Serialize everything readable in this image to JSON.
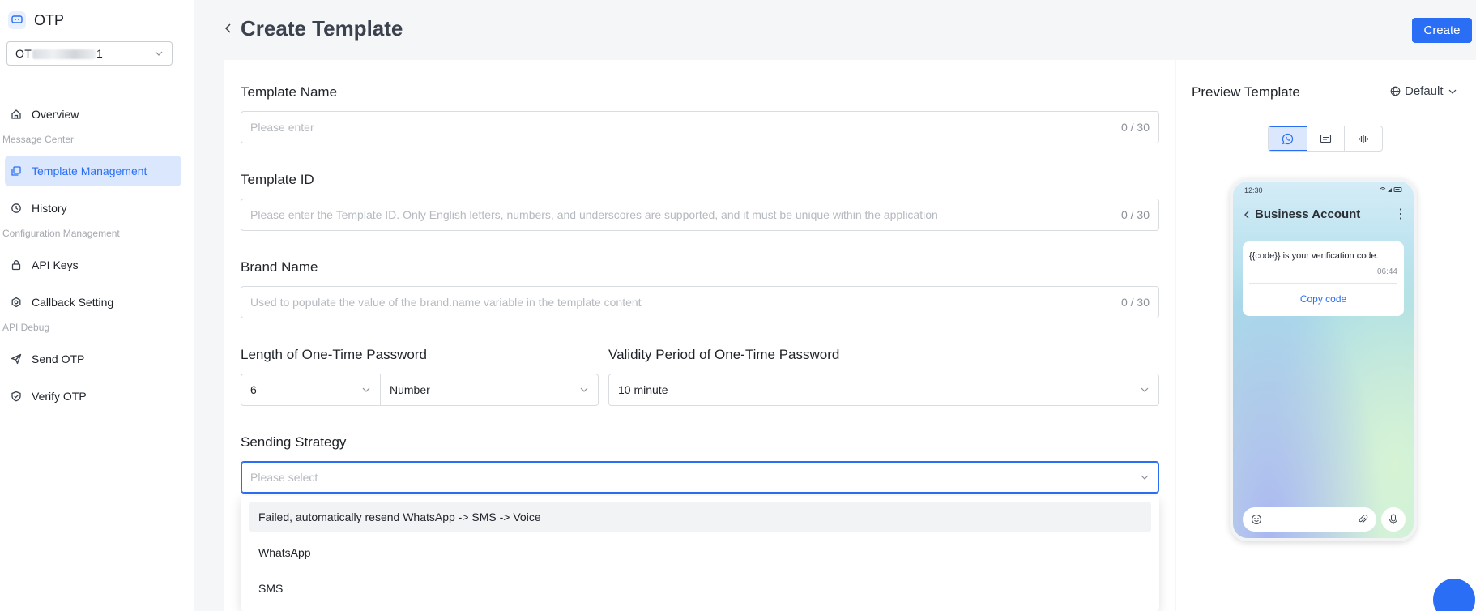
{
  "sidebar": {
    "app_title": "OTP",
    "app_select": {
      "prefix": "OT",
      "suffix": "1"
    },
    "items": {
      "overview": "Overview",
      "group_message": "Message Center",
      "template_management": "Template Management",
      "history": "History",
      "group_config": "Configuration Management",
      "api_keys": "API Keys",
      "callback": "Callback Setting",
      "group_debug": "API Debug",
      "send_otp": "Send OTP",
      "verify_otp": "Verify OTP"
    }
  },
  "header": {
    "title": "Create Template",
    "create_label": "Create"
  },
  "form": {
    "template_name": {
      "label": "Template Name",
      "placeholder": "Please enter",
      "count": "0 / 30"
    },
    "template_id": {
      "label": "Template ID",
      "placeholder": "Please enter the Template ID. Only English letters, numbers, and underscores are supported, and it must be unique within the application",
      "count": "0 / 30"
    },
    "brand_name": {
      "label": "Brand Name",
      "placeholder": "Used to populate the value of the brand.name variable in the template content",
      "count": "0 / 30"
    },
    "otp_length": {
      "label": "Length of One-Time Password",
      "length_value": "6",
      "type_value": "Number"
    },
    "validity": {
      "label": "Validity Period of One-Time Password",
      "value": "10 minute"
    },
    "strategy": {
      "label": "Sending Strategy",
      "placeholder": "Please select",
      "options": [
        "Failed, automatically resend WhatsApp -> SMS -> Voice",
        "WhatsApp",
        "SMS"
      ]
    }
  },
  "preview": {
    "title": "Preview Template",
    "language": "Default",
    "channels": [
      "whatsapp-icon",
      "sms-icon",
      "voice-icon"
    ],
    "phone": {
      "time": "12:30",
      "account": "Business Account",
      "message": "{{code}} is your verification code.",
      "message_time": "06:44",
      "copy_label": "Copy code"
    }
  },
  "colors": {
    "accent": "#2a6ef5",
    "active_bg": "#dbe7fd"
  }
}
